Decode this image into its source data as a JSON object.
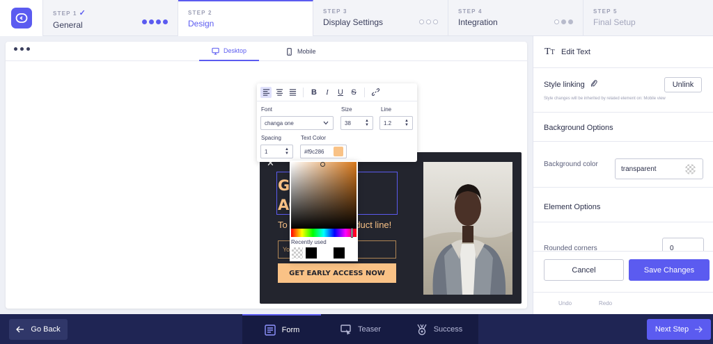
{
  "steps": [
    {
      "num": "STEP 1",
      "title": "General",
      "done": "✓"
    },
    {
      "num": "STEP 2",
      "title": "Design"
    },
    {
      "num": "STEP 3",
      "title": "Display Settings"
    },
    {
      "num": "STEP 4",
      "title": "Integration"
    },
    {
      "num": "STEP 5",
      "title": "Final Setup"
    }
  ],
  "canvas": {
    "device_tabs": {
      "desktop": "Desktop",
      "mobile": "Mobile"
    }
  },
  "popup": {
    "close": "✕",
    "headline_line1": "GE",
    "headline_line2": "AC",
    "subline_start": "To",
    "subline_end": "oduct line!",
    "email_placeholder": "Yo",
    "cta_label": "GET EARLY ACCESS NOW"
  },
  "toolbar": {
    "font_label": "Font",
    "font_value": "changa one",
    "size_label": "Size",
    "size_value": "38",
    "line_label": "Line",
    "line_value": "1.2",
    "spacing_label": "Spacing",
    "spacing_value": "1",
    "text_color_label": "Text Color",
    "text_color_value": "#f9c286"
  },
  "picker": {
    "recently_used_label": "Recently used"
  },
  "panel": {
    "title": "Edit Text",
    "style_linking_title": "Style linking",
    "unlink_label": "Unlink",
    "style_linking_note": "Style changes will be inherited by related element on: Mobile view",
    "background_options_title": "Background Options",
    "background_color_label": "Background color",
    "background_color_value": "transparent",
    "element_options_title": "Element Options",
    "rounded_corners_label": "Rounded corners",
    "rounded_corners_value": "0",
    "cancel_label": "Cancel",
    "save_label": "Save Changes",
    "undo_label": "Undo",
    "redo_label": "Redo"
  },
  "bottom": {
    "go_back_label": "Go Back",
    "tabs": {
      "form": "Form",
      "teaser": "Teaser",
      "success": "Success"
    },
    "next_step_label": "Next Step"
  },
  "colors": {
    "accent": "#5b5bf0",
    "popup_bg": "#23252e",
    "popup_text": "#f9c286",
    "bottom_bar": "#1f2554"
  }
}
